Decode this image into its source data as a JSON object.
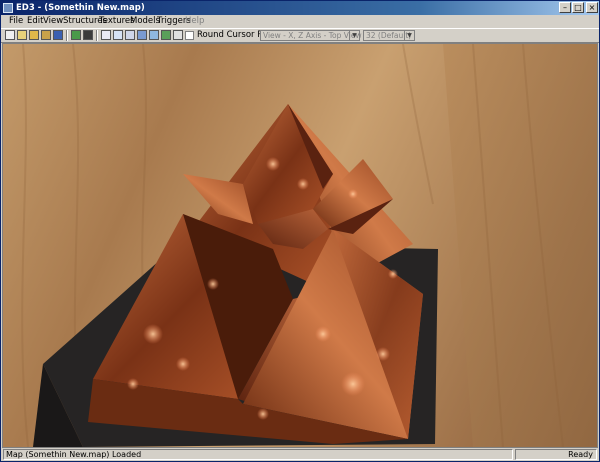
{
  "window": {
    "title": "ED3 - (Somethin New.map)"
  },
  "menu": {
    "items": [
      {
        "label": "File"
      },
      {
        "label": "Edit"
      },
      {
        "label": "View"
      },
      {
        "label": "Structures"
      },
      {
        "label": "Textures"
      },
      {
        "label": "Models"
      },
      {
        "label": "Triggers"
      },
      {
        "label": "Help",
        "disabled": true
      }
    ]
  },
  "toolbar": {
    "round_cursor_label": "Round Cursor Position",
    "view_combo_value": "View - X, Z Axis - Top View",
    "grid_combo_value": "32 (Default)",
    "icons": [
      "new-icon",
      "open-icon",
      "open-folder-icon",
      "import-icon",
      "save-icon",
      "render-icon",
      "grid-icon",
      "select-icon",
      "move-icon",
      "box-icon",
      "camera-icon",
      "texture-icon",
      "model-icon",
      "trigger-icon"
    ]
  },
  "colors": {
    "title_start": "#0a246a",
    "title_end": "#a6caf0",
    "chrome": "#d4d0c8",
    "copper": "#a0522d"
  },
  "status": {
    "left": "Map (Somethin New.map) Loaded",
    "right": "Ready"
  }
}
